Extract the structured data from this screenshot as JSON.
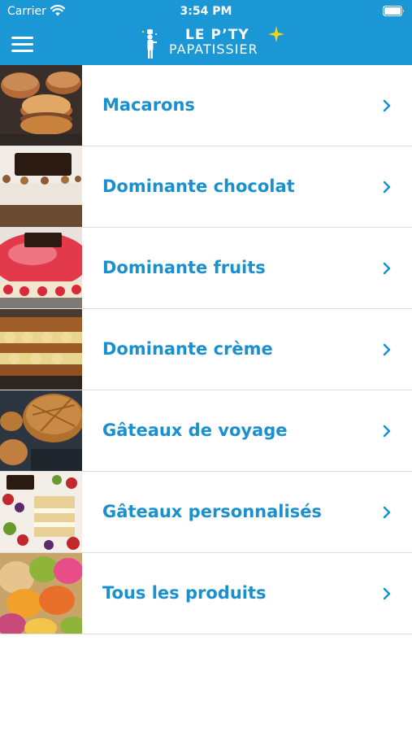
{
  "status_bar": {
    "carrier": "Carrier",
    "time": "3:54 PM"
  },
  "header": {
    "logo_line1": "LE P’TY",
    "logo_line2": "PAPATISSIER",
    "background_color": "#1b97d6"
  },
  "categories": [
    {
      "label": "Macarons"
    },
    {
      "label": "Dominante chocolat"
    },
    {
      "label": "Dominante fruits"
    },
    {
      "label": "Dominante crème"
    },
    {
      "label": "Gâteaux de voyage"
    },
    {
      "label": "Gâteaux personnalisés"
    },
    {
      "label": "Tous les produits"
    }
  ],
  "colors": {
    "accent": "#1b90cf",
    "separator": "#dcdcdc",
    "logo_star": "#f2d21b"
  }
}
